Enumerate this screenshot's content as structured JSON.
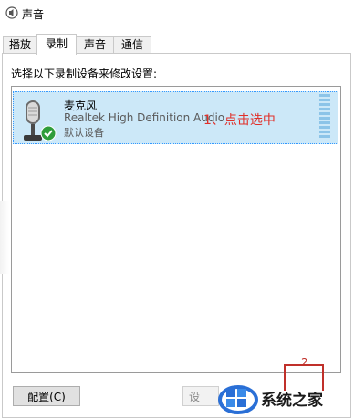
{
  "window": {
    "title": "声音"
  },
  "tabs": [
    {
      "label": "播放",
      "active": false
    },
    {
      "label": "录制",
      "active": true
    },
    {
      "label": "声音",
      "active": false
    },
    {
      "label": "通信",
      "active": false
    }
  ],
  "instruction": "选择以下录制设备来修改设置:",
  "device": {
    "name": "麦克风",
    "description": "Realtek High Definition Audio",
    "status": "默认设备",
    "icon": "microphone-icon",
    "badge_icon": "check-circle-icon",
    "selected": true
  },
  "annotations": {
    "step1": "1、点击选中",
    "step2": "2",
    "color": "#e0302a"
  },
  "buttons": {
    "configure": "配置(C)",
    "set_default": "设"
  },
  "watermark": {
    "text": "系统之家"
  },
  "colors": {
    "selection": "#cce8f8",
    "level": "#8cc4e8"
  }
}
